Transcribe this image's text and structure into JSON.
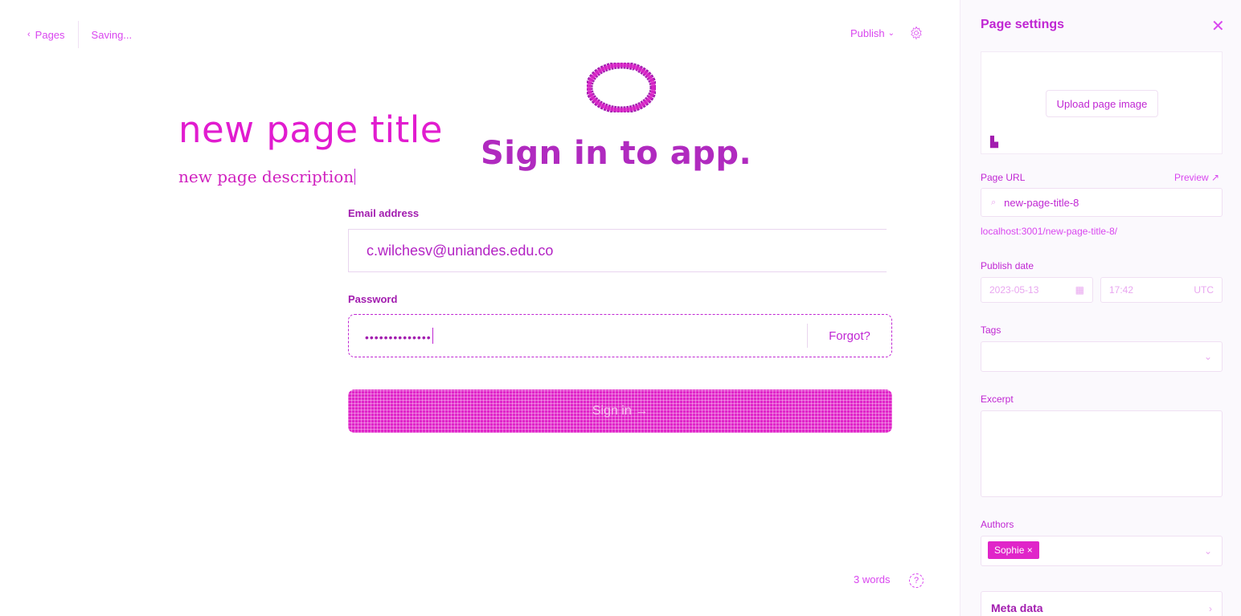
{
  "editor": {
    "back_label": "Pages",
    "status": "Saving...",
    "publish_label": "Publish",
    "page_title": "new page title",
    "page_description": "new page description",
    "word_count": "3 words",
    "help_glyph": "?"
  },
  "card": {
    "heading": "Sign in to app.",
    "email_label": "Email address",
    "email_value": "c.wilchesv@uniandes.edu.co",
    "password_label": "Password",
    "password_mask": "••••••••••••••",
    "forgot_label": "Forgot?",
    "signin_label": "Sign in →"
  },
  "settings": {
    "title": "Page settings",
    "close_glyph": "✕",
    "upload_label": "Upload page image",
    "url_label": "Page URL",
    "preview_label": "Preview ↗",
    "url_value": "new-page-title-8",
    "url_help": "localhost:3001/new-page-title-8/",
    "publish_date_label": "Publish date",
    "date_value": "2023-05-13",
    "time_value": "17:42",
    "tz_value": "UTC",
    "tags_label": "Tags",
    "excerpt_label": "Excerpt",
    "authors_label": "Authors",
    "author_chip": "Sophie ×",
    "meta_label": "Meta data"
  },
  "colors": {
    "accent": "#c026d3",
    "button": "#e025c9"
  }
}
